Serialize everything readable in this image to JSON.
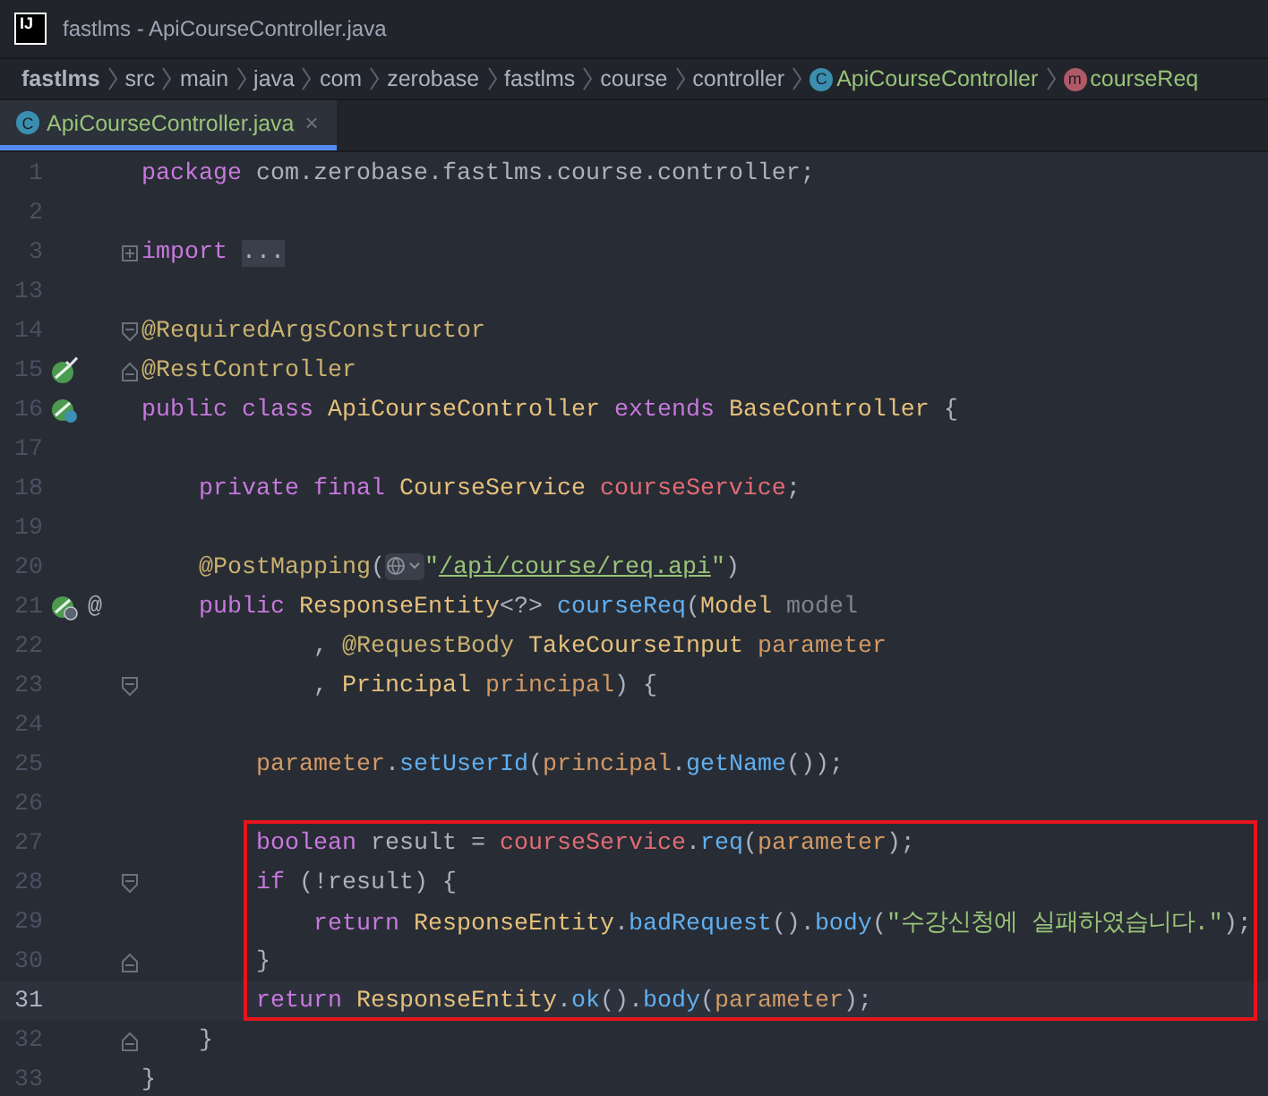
{
  "window": {
    "logo": "IJ",
    "title": "fastlms - ApiCourseController.java"
  },
  "breadcrumbs": [
    {
      "label": "fastlms",
      "kind": "project"
    },
    {
      "label": "src",
      "kind": "folder"
    },
    {
      "label": "main",
      "kind": "folder"
    },
    {
      "label": "java",
      "kind": "folder"
    },
    {
      "label": "com",
      "kind": "folder"
    },
    {
      "label": "zerobase",
      "kind": "folder"
    },
    {
      "label": "fastlms",
      "kind": "folder"
    },
    {
      "label": "course",
      "kind": "folder"
    },
    {
      "label": "controller",
      "kind": "folder"
    },
    {
      "label": "ApiCourseController",
      "kind": "class",
      "badge": "C"
    },
    {
      "label": "courseReq",
      "kind": "method",
      "badge": "m"
    }
  ],
  "tabs": [
    {
      "label": "ApiCourseController.java",
      "badge": "C",
      "close": "×",
      "selected": true
    }
  ],
  "lines": [
    {
      "number": "1",
      "current": false,
      "highlighted": false,
      "tokens": [
        {
          "text": "package ",
          "kind": "kw"
        },
        {
          "text": "com.zerobase.fastlms.course.controller;",
          "kind": "plain"
        }
      ]
    },
    {
      "number": "2",
      "current": false,
      "highlighted": false
    },
    {
      "number": "3",
      "current": false,
      "highlighted": false,
      "fold": {
        "kind": "expand"
      },
      "tokens": [
        {
          "text": "import ",
          "kind": "kw"
        },
        {
          "text": "...",
          "kind": "folded"
        }
      ]
    },
    {
      "number": "13",
      "current": false,
      "highlighted": false
    },
    {
      "number": "14",
      "current": false,
      "highlighted": false,
      "fold": {
        "kind": "start"
      },
      "tokens": [
        {
          "text": "@RequiredArgsConstructor",
          "kind": "ann"
        }
      ]
    },
    {
      "number": "15",
      "current": false,
      "highlighted": false,
      "fold": {
        "kind": "end"
      },
      "gutter_icon": {
        "kind": "bean-check"
      },
      "tokens": [
        {
          "text": "@RestController",
          "kind": "ann"
        }
      ]
    },
    {
      "number": "16",
      "current": false,
      "highlighted": false,
      "gutter_icon": {
        "kind": "bean-dot"
      },
      "tokens": [
        {
          "text": "public class ",
          "kind": "kw"
        },
        {
          "text": "ApiCourseController ",
          "kind": "cls"
        },
        {
          "text": "extends ",
          "kind": "kw"
        },
        {
          "text": "BaseController ",
          "kind": "cls"
        },
        {
          "text": "{",
          "kind": "plain"
        }
      ]
    },
    {
      "number": "17",
      "current": false,
      "highlighted": false
    },
    {
      "number": "18",
      "current": false,
      "highlighted": false,
      "tokens": [
        {
          "text": "    private final ",
          "kind": "kw"
        },
        {
          "text": "CourseService ",
          "kind": "cls"
        },
        {
          "text": "courseService",
          "kind": "field"
        },
        {
          "text": ";",
          "kind": "plain"
        }
      ]
    },
    {
      "number": "19",
      "current": false,
      "highlighted": false
    },
    {
      "number": "20",
      "current": false,
      "highlighted": false,
      "tokens": [
        {
          "text": "    @PostMapping",
          "kind": "ann"
        },
        {
          "text": "(",
          "kind": "plain"
        },
        {
          "kind": "inlay"
        },
        {
          "text": "\"",
          "kind": "str"
        },
        {
          "text": "/api/course/req.api",
          "kind": "url"
        },
        {
          "text": "\"",
          "kind": "str"
        },
        {
          "text": ")",
          "kind": "plain"
        }
      ]
    },
    {
      "number": "21",
      "current": false,
      "highlighted": false,
      "gutter_icon": {
        "kind": "globe-bean"
      },
      "gutter_text": "@",
      "tokens": [
        {
          "text": "    public ",
          "kind": "kw"
        },
        {
          "text": "ResponseEntity",
          "kind": "cls"
        },
        {
          "text": "<?> ",
          "kind": "plain"
        },
        {
          "text": "courseReq",
          "kind": "fn"
        },
        {
          "text": "(",
          "kind": "plain"
        },
        {
          "text": "Model ",
          "kind": "cls"
        },
        {
          "text": "model",
          "kind": "unused"
        }
      ]
    },
    {
      "number": "22",
      "current": false,
      "highlighted": false,
      "tokens": [
        {
          "text": "            , ",
          "kind": "plain"
        },
        {
          "text": "@RequestBody ",
          "kind": "ann"
        },
        {
          "text": "TakeCourseInput ",
          "kind": "cls"
        },
        {
          "text": "parameter",
          "kind": "param"
        }
      ]
    },
    {
      "number": "23",
      "current": false,
      "highlighted": false,
      "fold": {
        "kind": "start"
      },
      "tokens": [
        {
          "text": "            , ",
          "kind": "plain"
        },
        {
          "text": "Principal ",
          "kind": "cls"
        },
        {
          "text": "principal",
          "kind": "param"
        },
        {
          "text": ") {",
          "kind": "plain"
        }
      ]
    },
    {
      "number": "24",
      "current": false,
      "highlighted": false
    },
    {
      "number": "25",
      "current": false,
      "highlighted": false,
      "tokens": [
        {
          "text": "        parameter",
          "kind": "param"
        },
        {
          "text": ".",
          "kind": "plain"
        },
        {
          "text": "setUserId",
          "kind": "fn"
        },
        {
          "text": "(",
          "kind": "plain"
        },
        {
          "text": "principal",
          "kind": "param"
        },
        {
          "text": ".",
          "kind": "plain"
        },
        {
          "text": "getName",
          "kind": "fn"
        },
        {
          "text": "());",
          "kind": "plain"
        }
      ]
    },
    {
      "number": "26",
      "current": false,
      "highlighted": false
    },
    {
      "number": "27",
      "current": false,
      "highlighted": true,
      "tokens": [
        {
          "text": "        boolean ",
          "kind": "kw"
        },
        {
          "text": "result = ",
          "kind": "plain"
        },
        {
          "text": "courseService",
          "kind": "field"
        },
        {
          "text": ".",
          "kind": "plain"
        },
        {
          "text": "req",
          "kind": "fn"
        },
        {
          "text": "(",
          "kind": "plain"
        },
        {
          "text": "parameter",
          "kind": "param"
        },
        {
          "text": ");",
          "kind": "plain"
        }
      ]
    },
    {
      "number": "28",
      "current": false,
      "highlighted": true,
      "fold": {
        "kind": "start"
      },
      "tokens": [
        {
          "text": "        if ",
          "kind": "kw"
        },
        {
          "text": "(!result) {",
          "kind": "plain"
        }
      ]
    },
    {
      "number": "29",
      "current": false,
      "highlighted": true,
      "tokens": [
        {
          "text": "            return ",
          "kind": "kw"
        },
        {
          "text": "ResponseEntity",
          "kind": "cls"
        },
        {
          "text": ".",
          "kind": "plain"
        },
        {
          "text": "badRequest",
          "kind": "fn"
        },
        {
          "text": "().",
          "kind": "plain"
        },
        {
          "text": "body",
          "kind": "fn"
        },
        {
          "text": "(",
          "kind": "plain"
        },
        {
          "text": "\"수강신청에 실패하였습니다.\"",
          "kind": "str"
        },
        {
          "text": ");",
          "kind": "plain"
        }
      ]
    },
    {
      "number": "30",
      "current": false,
      "highlighted": true,
      "fold": {
        "kind": "end"
      },
      "tokens": [
        {
          "text": "        }",
          "kind": "plain"
        }
      ]
    },
    {
      "number": "31",
      "current": true,
      "highlighted": true,
      "tokens": [
        {
          "text": "        return ",
          "kind": "kw"
        },
        {
          "text": "ResponseEntity",
          "kind": "cls"
        },
        {
          "text": ".",
          "kind": "plain"
        },
        {
          "text": "ok",
          "kind": "fn"
        },
        {
          "text": "().",
          "kind": "plain"
        },
        {
          "text": "body",
          "kind": "fn"
        },
        {
          "text": "(",
          "kind": "plain"
        },
        {
          "text": "parameter",
          "kind": "param"
        },
        {
          "text": ");",
          "kind": "plain"
        }
      ]
    },
    {
      "number": "32",
      "current": false,
      "highlighted": false,
      "fold": {
        "kind": "end"
      },
      "tokens": [
        {
          "text": "    }",
          "kind": "plain"
        }
      ]
    },
    {
      "number": "33",
      "current": false,
      "highlighted": false,
      "tokens": [
        {
          "text": "}",
          "kind": "plain"
        }
      ]
    }
  ]
}
